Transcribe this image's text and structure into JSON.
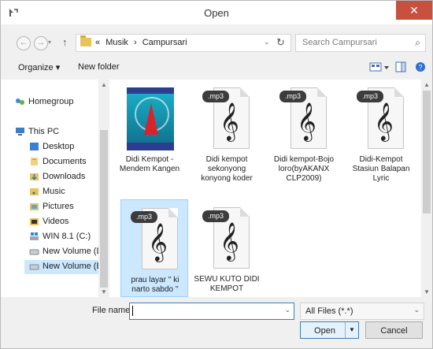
{
  "window": {
    "title": "Open",
    "close_glyph": "✕"
  },
  "nav_buttons": {
    "back": "←",
    "forward": "→",
    "dropdown": "▾",
    "up": "↑"
  },
  "address": {
    "prefix": "«",
    "crumbs": [
      "Musik",
      "›",
      "Campursari"
    ],
    "dropdown": "⌄",
    "refresh": "↻"
  },
  "search": {
    "placeholder": "Search Campursari",
    "icon": "⌕"
  },
  "toolbar": {
    "organize": "Organize ▾",
    "new_folder": "New folder"
  },
  "sidebar": {
    "items": [
      {
        "label": "Homegroup",
        "icon": "homegroup-icon"
      },
      {
        "label": "This PC",
        "icon": "computer-icon"
      },
      {
        "label": "Desktop",
        "icon": "desktop-icon"
      },
      {
        "label": "Documents",
        "icon": "documents-icon"
      },
      {
        "label": "Downloads",
        "icon": "downloads-icon"
      },
      {
        "label": "Music",
        "icon": "music-icon"
      },
      {
        "label": "Pictures",
        "icon": "pictures-icon"
      },
      {
        "label": "Videos",
        "icon": "videos-icon"
      },
      {
        "label": "WIN 8.1 (C:)",
        "icon": "drive-icon"
      },
      {
        "label": "New Volume (D:)",
        "icon": "drive-icon"
      },
      {
        "label": "New Volume (E:)",
        "icon": "drive-icon"
      }
    ]
  },
  "files": [
    {
      "caption": "Didi Kempot - Mendem Kangen",
      "kind": "album-art"
    },
    {
      "caption": "Didi kempot sekonyong konyong koder",
      "kind": "mp3",
      "tag": ".mp3"
    },
    {
      "caption": "Didi kempot-Bojo loro(byAKANX CLP2009)",
      "kind": "mp3",
      "tag": ".mp3"
    },
    {
      "caption": "Didi-Kempot Stasiun Balapan Lyric",
      "kind": "mp3",
      "tag": ".mp3"
    },
    {
      "caption": "prau layar '' ki narto sabdo ''",
      "kind": "mp3",
      "tag": ".mp3"
    },
    {
      "caption": "SEWU KUTO DIDI KEMPOT",
      "kind": "mp3",
      "tag": ".mp3"
    }
  ],
  "bottom": {
    "file_name_label": "File name:",
    "file_name_value": "",
    "filter_value": "All Files (*.*)",
    "open_label": "Open",
    "cancel_label": "Cancel",
    "dropdown_glyph": "⌄"
  },
  "colors": {
    "close": "#c7503f",
    "selection": "#cce8ff",
    "folder": "#e8c35a"
  }
}
